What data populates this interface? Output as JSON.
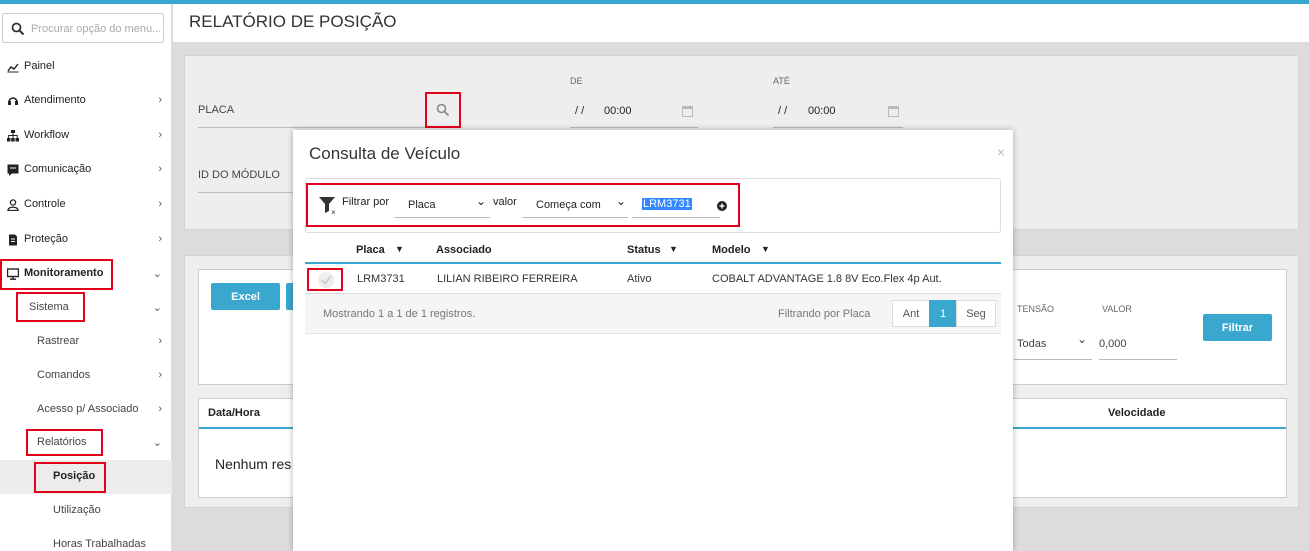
{
  "sidebar": {
    "search_placeholder": "Procurar opção do menu...",
    "items": [
      {
        "label": "Painel"
      },
      {
        "label": "Atendimento"
      },
      {
        "label": "Workflow"
      },
      {
        "label": "Comunicação"
      },
      {
        "label": "Controle"
      },
      {
        "label": "Proteção"
      },
      {
        "label": "Monitoramento"
      }
    ],
    "sub_items": [
      {
        "label": "Sistema"
      },
      {
        "label": "Rastrear"
      },
      {
        "label": "Comandos"
      },
      {
        "label": "Acesso p/ Associado"
      },
      {
        "label": "Relatórios"
      },
      {
        "label": "Posição"
      },
      {
        "label": "Utilização"
      },
      {
        "label": "Horas Trabalhadas"
      }
    ]
  },
  "page": {
    "title": "RELATÓRIO DE POSIÇÃO"
  },
  "filters": {
    "placa_label": "PLACA",
    "modulo_label": "ID DO MÓDULO",
    "de_label": "DE",
    "ate_label": "ATÉ",
    "de_date": "/ /",
    "de_time": "00:00",
    "ate_date": "/ /",
    "ate_time": "00:00"
  },
  "results": {
    "excel_button": "Excel",
    "tensao_label": "TENSÃO",
    "tensao_value": "Todas",
    "valor_label": "VALOR",
    "valor_value": "0,000",
    "filter_button": "Filtrar",
    "col_datahora": "Data/Hora",
    "col_velocidade": "Velocidade",
    "empty_text": "Nenhum res"
  },
  "modal": {
    "title": "Consulta de Veículo",
    "close": "×",
    "filter_by_label": "Filtrar por",
    "filter_by_value": "Placa",
    "valor_label": "valor",
    "match_value": "Começa com",
    "search_value": "LRM3731",
    "columns": [
      "Placa",
      "Associado",
      "Status",
      "Modelo"
    ],
    "rows": [
      {
        "placa": "LRM3731",
        "associado": "LILIAN RIBEIRO FERREIRA",
        "status": "Ativo",
        "modelo": "COBALT ADVANTAGE 1.8 8V Eco.Flex 4p Aut."
      }
    ],
    "footer_info": "Mostrando 1 a 1 de 1 registros.",
    "filtering_info": "Filtrando por Placa",
    "pager": {
      "prev": "Ant",
      "current": "1",
      "next": "Seg"
    }
  },
  "colors": {
    "accent": "#3aa7cf",
    "highlight": "#e3001b"
  }
}
